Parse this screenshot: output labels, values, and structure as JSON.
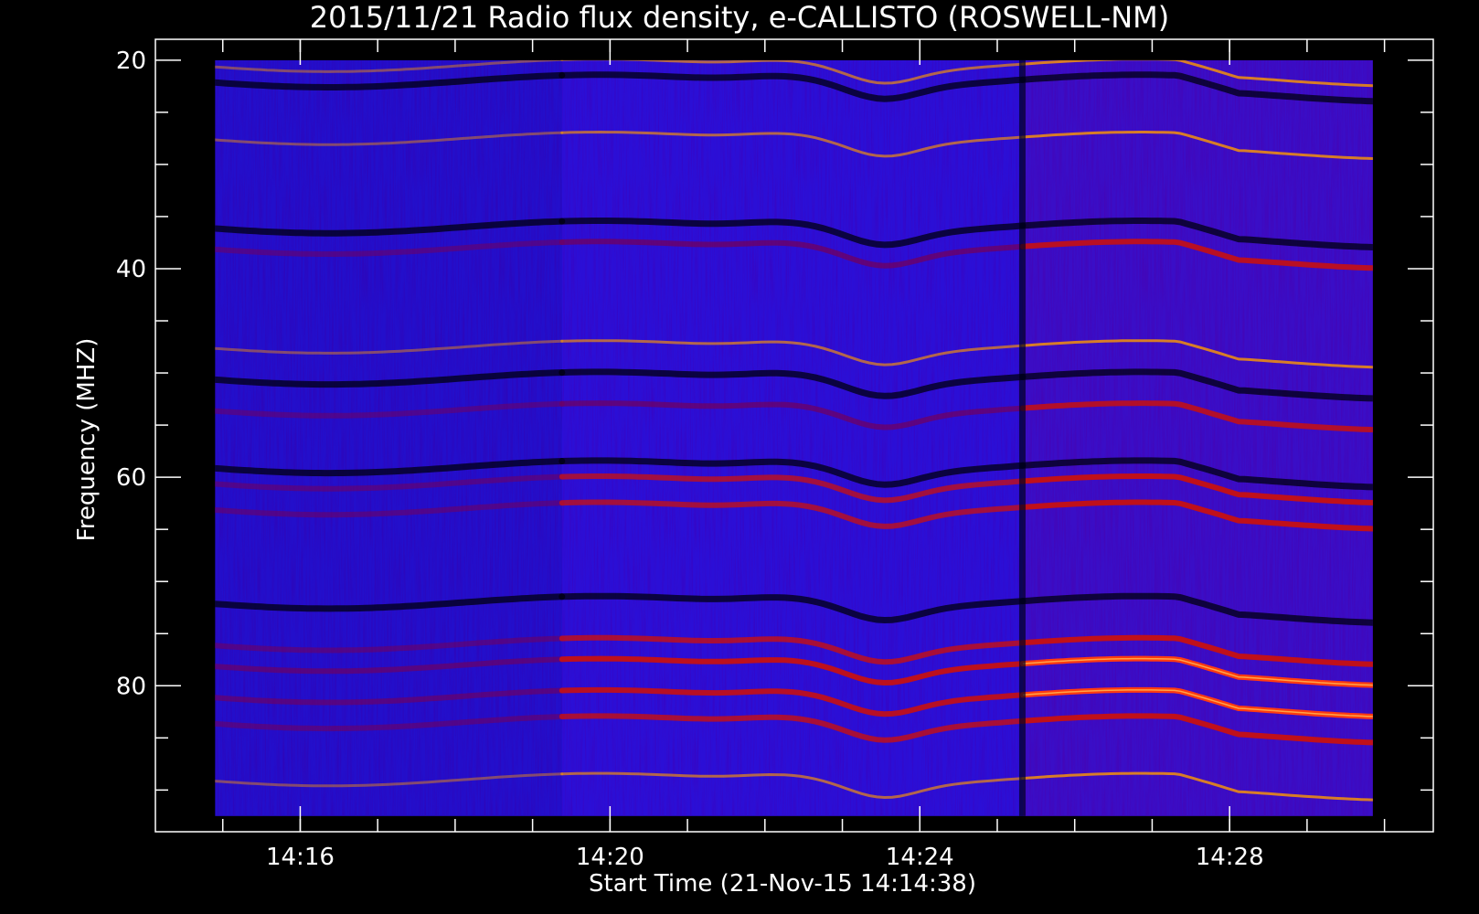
{
  "chart_data": {
    "type": "heatmap",
    "title": "2015/11/21  Radio flux density, e-CALLISTO (ROSWELL-NM)",
    "xlabel": "Start Time (21-Nov-15 14:14:38)",
    "ylabel": "Frequency (MHZ)",
    "x_ticks": [
      "14:16",
      "14:20",
      "14:24",
      "14:28"
    ],
    "x_tick_minutes": [
      1.37,
      5.37,
      9.37,
      13.37
    ],
    "x_range_minutes": [
      -0.5,
      16.0
    ],
    "data_x_range_minutes": [
      0.27,
      15.22
    ],
    "y_ticks": [
      "20",
      "40",
      "60",
      "80"
    ],
    "y_tick_values": [
      20,
      40,
      60,
      80
    ],
    "y_range": [
      18,
      94
    ],
    "y_minor_step": 5,
    "data_y_range": [
      20,
      92.5
    ],
    "y_inverted": true,
    "grid": false,
    "colormap": [
      "#000000",
      "#2000ff",
      "#1a00e0",
      "#c00000",
      "#ff2000",
      "#ffd000",
      "#ffffff"
    ],
    "background_level": "#2a12e8",
    "segments": [
      {
        "x_start": 0.27,
        "x_end": 4.75,
        "description_level": "quiet"
      },
      {
        "x_start": 4.75,
        "x_end": 10.7,
        "description_level": "moderate"
      },
      {
        "x_start": 10.7,
        "x_end": 15.22,
        "description_level": "bright"
      }
    ],
    "bands": [
      {
        "freq": 20.5,
        "intensity": 0.9,
        "type": "rfi"
      },
      {
        "freq": 22,
        "intensity": -0.8,
        "type": "dark"
      },
      {
        "freq": 27.5,
        "intensity": 0.85,
        "type": "rfi"
      },
      {
        "freq": 36,
        "intensity": -0.6,
        "type": "dark"
      },
      {
        "freq": 38,
        "intensity": 0.6,
        "type": "burst"
      },
      {
        "freq": 47.5,
        "intensity": 0.7,
        "type": "rfi"
      },
      {
        "freq": 50.5,
        "intensity": -0.9,
        "type": "dark"
      },
      {
        "freq": 53.5,
        "intensity": 0.55,
        "type": "burst"
      },
      {
        "freq": 59,
        "intensity": -0.6,
        "type": "dark"
      },
      {
        "freq": 60.5,
        "intensity": 0.65,
        "type": "burst"
      },
      {
        "freq": 63,
        "intensity": 0.65,
        "type": "burst"
      },
      {
        "freq": 72,
        "intensity": -0.7,
        "type": "dark"
      },
      {
        "freq": 76,
        "intensity": 0.7,
        "type": "burst"
      },
      {
        "freq": 78,
        "intensity": 0.9,
        "type": "burst"
      },
      {
        "freq": 81,
        "intensity": 0.85,
        "type": "burst"
      },
      {
        "freq": 83.5,
        "intensity": 0.7,
        "type": "burst"
      },
      {
        "freq": 89,
        "intensity": 0.6,
        "type": "rfi"
      }
    ]
  }
}
